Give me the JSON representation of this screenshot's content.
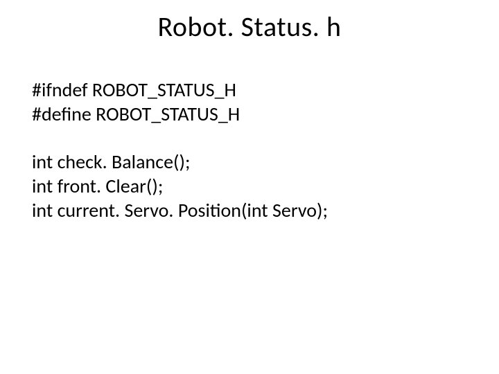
{
  "title": "Robot. Status. h",
  "code": {
    "l1": "#ifndef ROBOT_STATUS_H",
    "l2": "#define ROBOT_STATUS_H",
    "l3": "int check. Balance();",
    "l4": "int front. Clear();",
    "l5": "int current. Servo. Position(int Servo);"
  }
}
